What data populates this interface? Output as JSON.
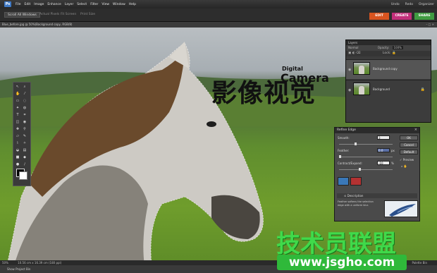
{
  "menubar": {
    "logo": "Ps",
    "items": [
      "File",
      "Edit",
      "Image",
      "Enhance",
      "Layer",
      "Select",
      "Filter",
      "View",
      "Window",
      "Help"
    ],
    "right": [
      "Undo",
      "Redo",
      "Organizer"
    ]
  },
  "tabs": {
    "items": [
      "Scroll All Windows",
      "Actual Pixels",
      "Fit Screen",
      "Print Size"
    ]
  },
  "modes": [
    {
      "label": "EDIT",
      "color": "#d9541f"
    },
    {
      "label": "CREATE",
      "color": "#c22f7a"
    },
    {
      "label": "SHARE",
      "color": "#3f9b41"
    }
  ],
  "document": {
    "title": "Blue_before.jpg @ 50%(Background copy, RGB/8)",
    "controls": "– □ ×"
  },
  "watermark": {
    "chinese": "影像视觉",
    "camera": "Camera",
    "digital": "Digital",
    "green": "技术员联盟",
    "url": "www.jsgho.com"
  },
  "layers_panel": {
    "title": "Layers",
    "blend_mode": "Normal",
    "opacity_label": "Opacity:",
    "opacity_value": "100%",
    "lock_label": "Lock:",
    "layers": [
      {
        "name": "Background copy",
        "locked": false
      },
      {
        "name": "Background",
        "locked": true
      }
    ]
  },
  "refine_edge": {
    "title": "Refine Edge",
    "close": "×",
    "smooth_label": "Smooth:",
    "smooth_value": "3",
    "feather_label": "Feather:",
    "feather_value": "0.0",
    "feather_unit": "px",
    "contract_label": "Contract/Expand:",
    "contract_value": "-10",
    "contract_unit": "%",
    "ok": "OK",
    "cancel": "Cancel",
    "default": "Default",
    "preview": "Preview",
    "description_label": "Description",
    "description_text": "Feather softens the selection edge with a uniform blur."
  },
  "status": {
    "zoom": "50%",
    "size": "10.56 cm x 16.39 cm (180 ppi)",
    "right": "Palette Bin"
  },
  "bottombar": {
    "left": "Show Project Bin"
  }
}
